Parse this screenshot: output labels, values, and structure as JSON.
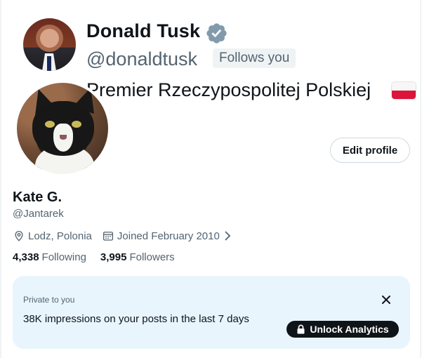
{
  "banner": {
    "name": "Donald Tusk",
    "handle": "@donaldtusk",
    "follows_badge": "Follows you",
    "bio": "Premier Rzeczypospolitej Polskiej",
    "verified_icon": "verified-badge-icon",
    "flag_icon": "poland-flag-icon"
  },
  "profile": {
    "name": "Kate G.",
    "handle": "@Jantarek",
    "location": "Lodz, Polonia",
    "joined": "Joined February 2010",
    "edit_label": "Edit profile",
    "following_count": "4,338",
    "following_label": "Following",
    "followers_count": "3,995",
    "followers_label": "Followers"
  },
  "analytics": {
    "label": "Private to you",
    "text": "38K impressions on your posts in the last 7 days",
    "button": "Unlock Analytics"
  },
  "colors": {
    "accent": "#1d9bf0",
    "card_bg": "#e8f5fd",
    "muted_text": "#536471",
    "primary_text": "#0f1419"
  }
}
